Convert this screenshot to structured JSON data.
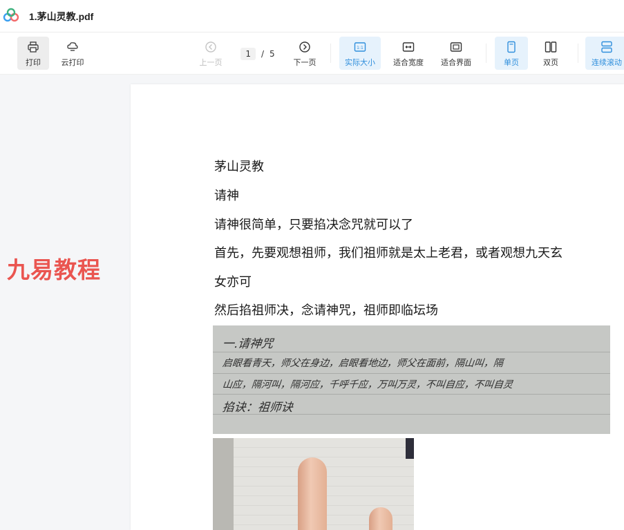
{
  "titlebar": {
    "title": "1.茅山灵教.pdf"
  },
  "colors": {
    "accent": "#2f8fdc",
    "brand": "#ea5550"
  },
  "toolbar": {
    "print": "打印",
    "cloud_print": "云打印",
    "prev": "上一页",
    "page_current": "1",
    "page_sep": "/",
    "page_total": "5",
    "next": "下一页",
    "actual_size": "实际大小",
    "fit_width": "适合宽度",
    "fit_page": "适合界面",
    "single_page": "单页",
    "double_page": "双页",
    "continuous": "连续滚动"
  },
  "left_panel": {
    "brand_text": "九易教程"
  },
  "document": {
    "paragraphs": [
      "茅山灵教",
      "请神",
      "请神很简单，只要掐决念咒就可以了",
      "首先，先要观想祖师，我们祖师就是太上老君，或者观想九天玄",
      "女亦可",
      "然后掐祖师决，念请神咒，祖师即临坛场"
    ],
    "handwriting": [
      "一.请神咒",
      "启眼看青天，师父在身边，启眼看地边，师父在面前，隔山叫，隔",
      "山应，隔河叫，隔河应，千呼千应，万叫万灵，不叫自应，不叫自灵",
      "掐诀：祖师诀"
    ]
  }
}
